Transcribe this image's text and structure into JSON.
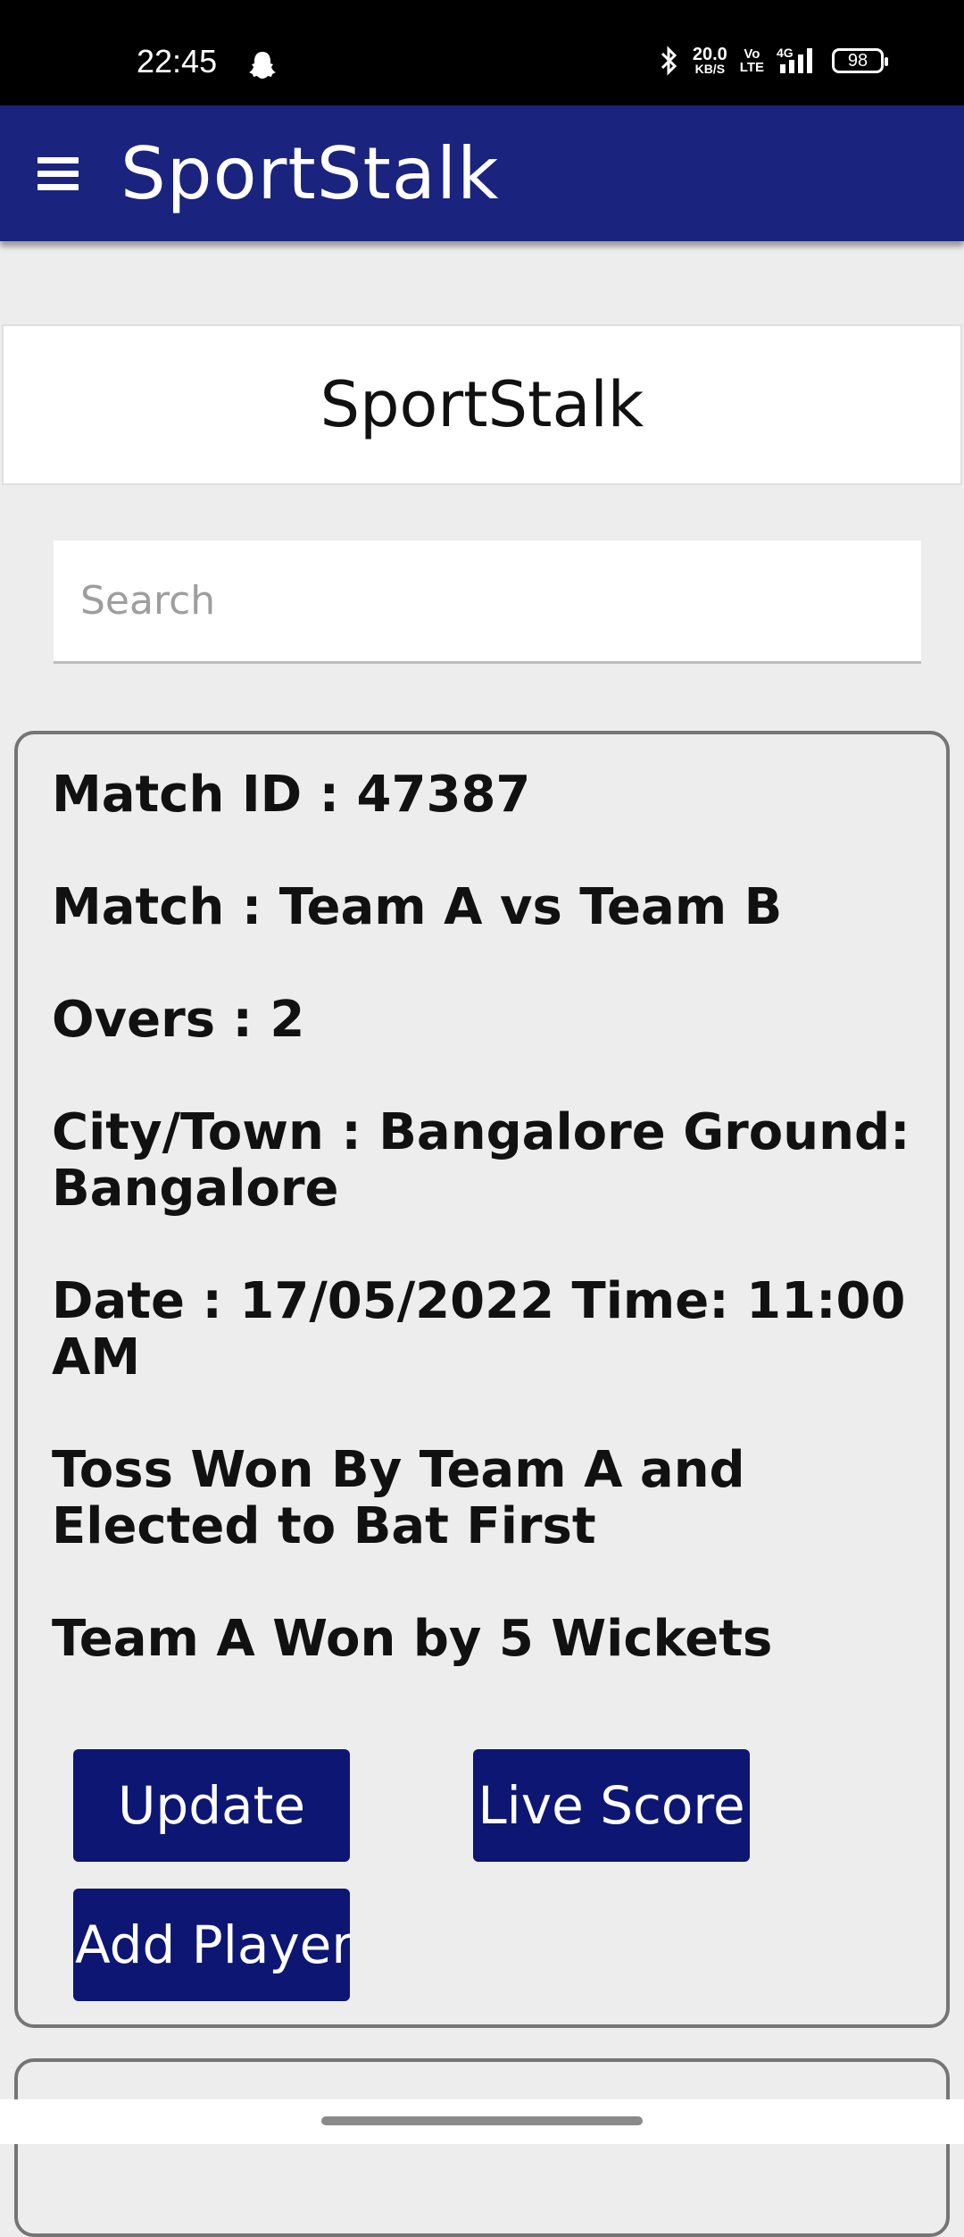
{
  "status_bar": {
    "time": "22:45",
    "net_speed_value": "20.0",
    "net_speed_unit": "KB/S",
    "volte_top": "Vo",
    "volte_bottom": "LTE",
    "network": "4G",
    "battery": "98"
  },
  "app_bar": {
    "title": "SportStalk"
  },
  "header_card": {
    "title": "SportStalk"
  },
  "search": {
    "placeholder": "Search",
    "value": ""
  },
  "match": {
    "match_id": "Match ID     : 47387",
    "match": "Match     : Team A vs Team B",
    "overs": "Overs : 2",
    "location": "City/Town : Bangalore   Ground: Bangalore",
    "datetime": "Date : 17/05/2022    Time: 11:00 AM",
    "toss": "Toss Won By Team A and Elected to Bat First",
    "result": "Team A Won by 5 Wickets",
    "buttons": {
      "update": "Update",
      "live_score": "Live Score",
      "add_player": "Add Player"
    }
  },
  "colors": {
    "app_bar": "#1a237e",
    "button": "#0d1672",
    "background": "#ededed"
  }
}
